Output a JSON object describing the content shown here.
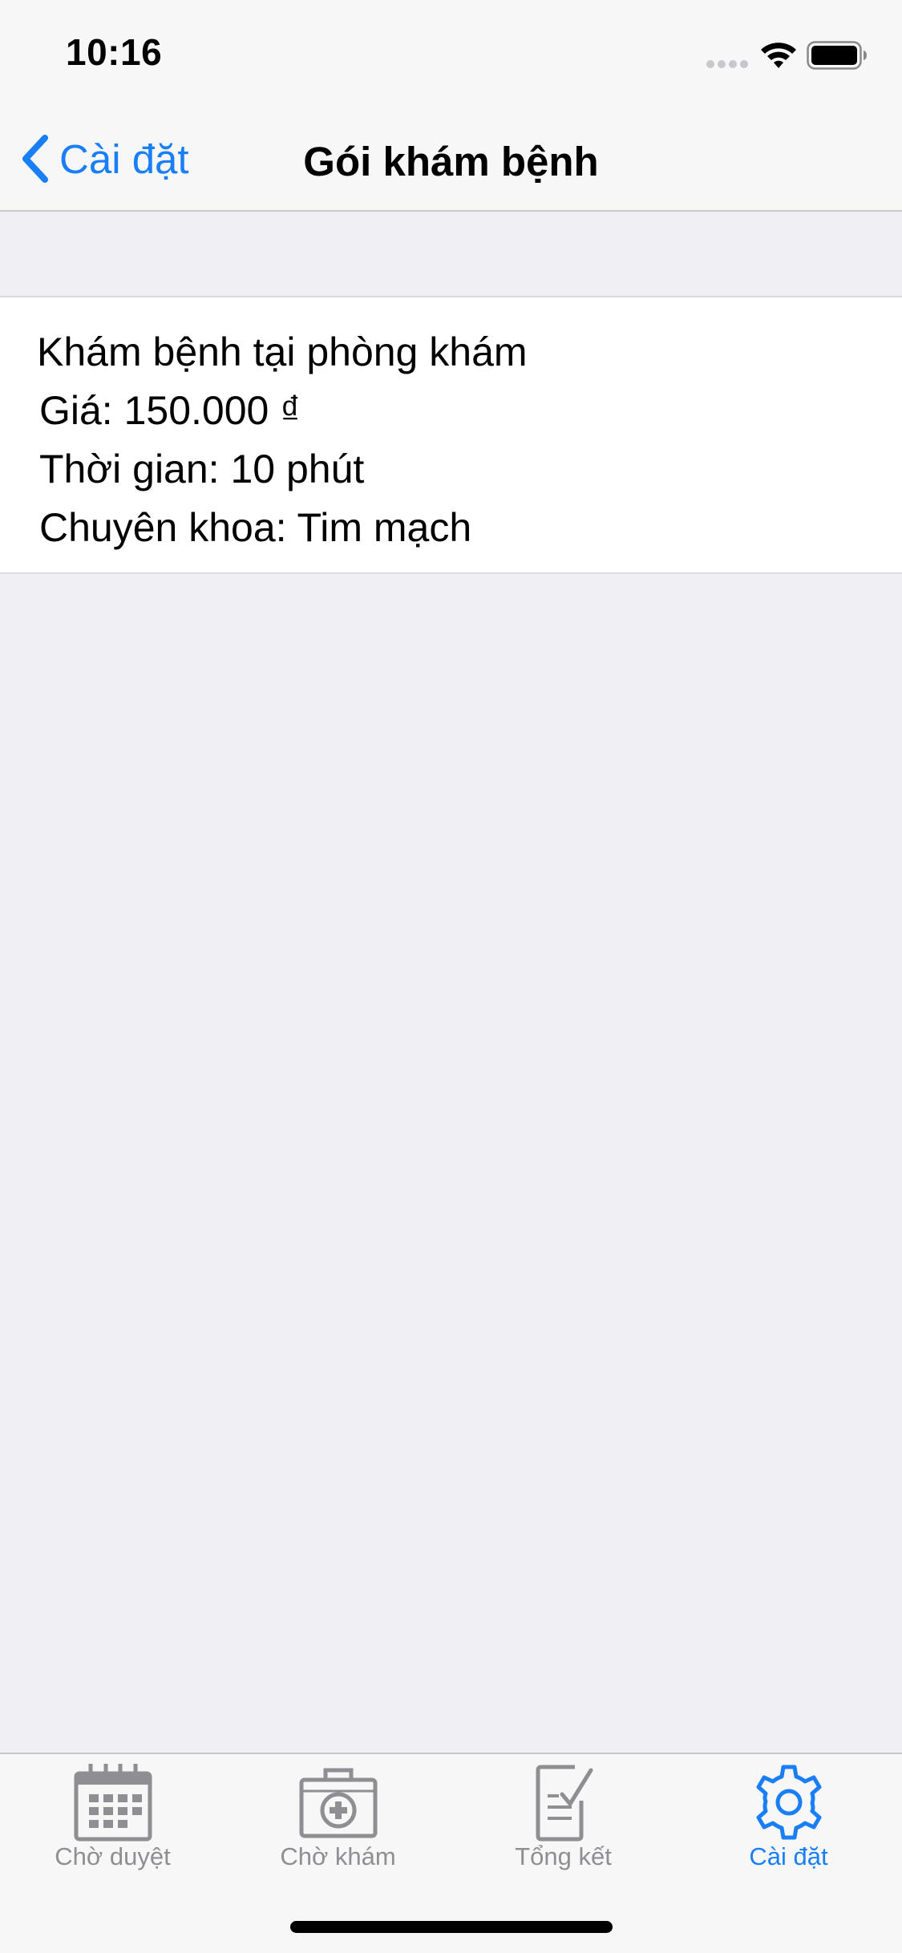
{
  "status_bar": {
    "time": "10:16"
  },
  "nav": {
    "back_label": "Cài đặt",
    "title": "Gói khám bệnh"
  },
  "package": {
    "title": "Khám bệnh tại phòng khám",
    "price": "Giá: 150.000 ₫",
    "duration": "Thời gian: 10 phút",
    "specialty": "Chuyên khoa: Tim mạch"
  },
  "tabs": [
    {
      "label": "Chờ duyệt",
      "icon": "calendar-icon",
      "active": false
    },
    {
      "label": "Chờ khám",
      "icon": "medical-kit-icon",
      "active": false
    },
    {
      "label": "Tổng kết",
      "icon": "checklist-icon",
      "active": false
    },
    {
      "label": "Cài đặt",
      "icon": "gear-icon",
      "active": true
    }
  ],
  "colors": {
    "accent": "#1a7ff7",
    "inactive_tab": "#8e8e93",
    "background": "#efeff4",
    "bar_background": "#f7f7f7"
  }
}
